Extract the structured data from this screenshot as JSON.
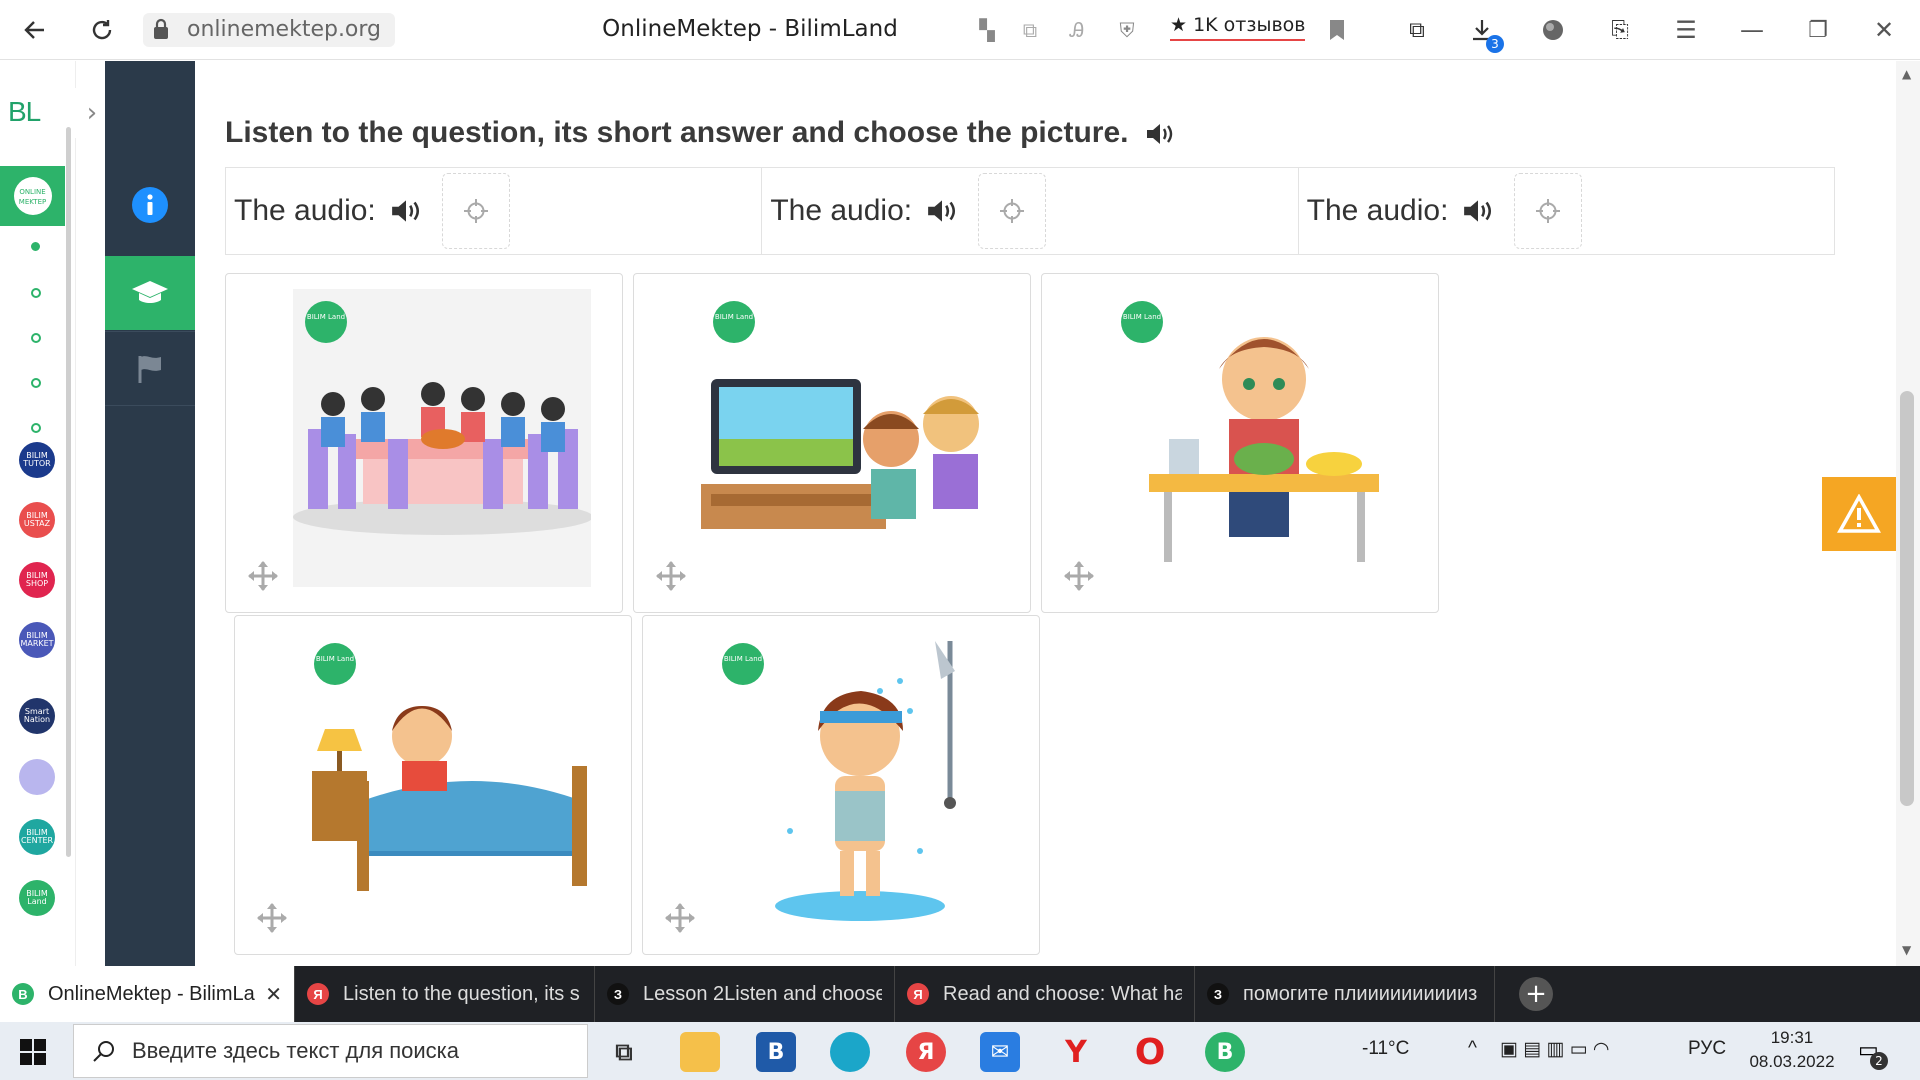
{
  "browser": {
    "url": "onlinemektep.org",
    "title": "OnlineMektep - BilimLand",
    "reviews": "1K отзывов",
    "downloads_badge": "3"
  },
  "sidebar": {
    "logo": "BL",
    "online_tile": "ONLINE MEKTEP",
    "apps": [
      {
        "label": "BILIM TUTOR",
        "color": "#1b3a8c"
      },
      {
        "label": "BILIM USTAZ",
        "color": "#e94e4e"
      },
      {
        "label": "BILIM SHOP",
        "color": "#e0254f"
      },
      {
        "label": "BILIM MARKET",
        "color": "#4a58b8"
      },
      {
        "label": "Smart Nation",
        "color": "#21356b"
      },
      {
        "label": "",
        "color": "#b9b6ee"
      },
      {
        "label": "BILIM CENTER",
        "color": "#1fa7a0"
      },
      {
        "label": "BILIM Land",
        "color": "#2db36a"
      }
    ]
  },
  "lesson": {
    "question": "Listen to the question, its short answer and choose the picture.",
    "audio_label": "The audio:",
    "audio_slots": 3,
    "cards": [
      {
        "name": "family-dinner"
      },
      {
        "name": "watching-tv"
      },
      {
        "name": "eating-salad"
      },
      {
        "name": "waking-up"
      },
      {
        "name": "taking-shower"
      }
    ],
    "card_badge": "BILIM Land"
  },
  "tabs": [
    {
      "label": "OnlineMektep - BilimLand",
      "icon": "bilimland",
      "color": "#2db36a",
      "active": true
    },
    {
      "label": "Listen to the question, its s",
      "icon": "Я",
      "color": "#e64545",
      "active": false
    },
    {
      "label": "Lesson 2Listen and choose",
      "icon": "З",
      "color": "#222",
      "active": false
    },
    {
      "label": "Read and choose: What ha",
      "icon": "Я",
      "color": "#e64545",
      "active": false
    },
    {
      "label": "помогите плииииииииииз",
      "icon": "З",
      "color": "#222",
      "active": false
    }
  ],
  "taskbar": {
    "search_placeholder": "Введите здесь текст для поиска",
    "temperature": "-11°C",
    "language": "РУС",
    "time": "19:31",
    "date": "08.03.2022",
    "notifications": "2"
  }
}
